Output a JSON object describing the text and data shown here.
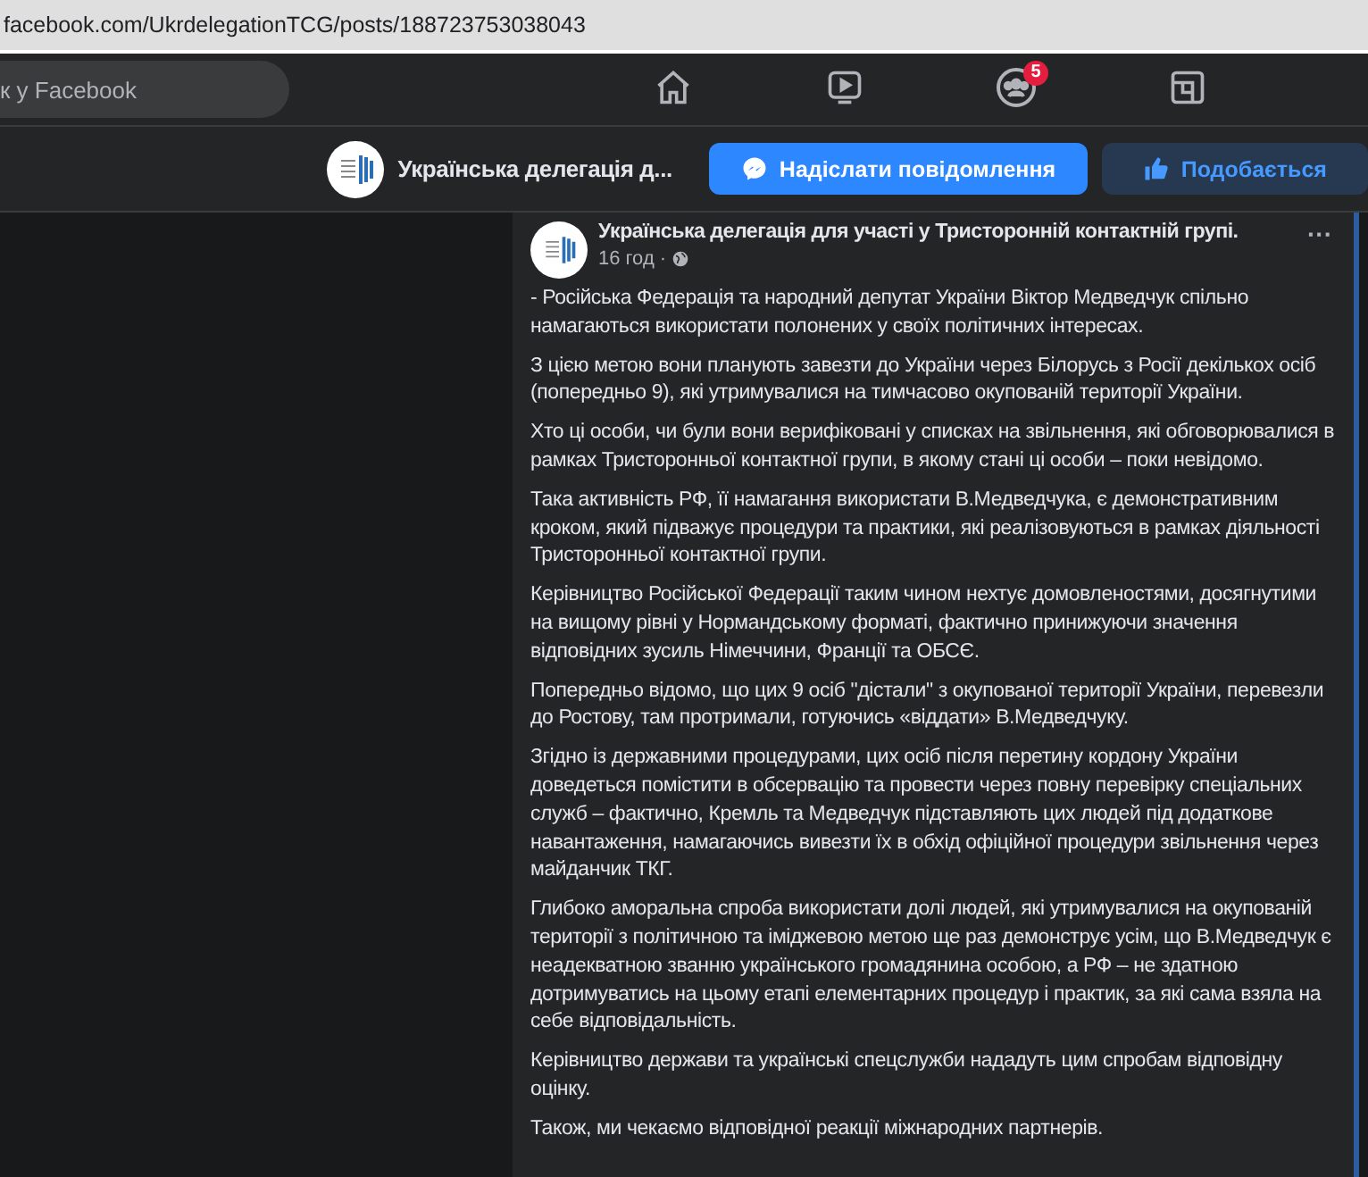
{
  "address_bar": {
    "url": "facebook.com/UkrdelegationTCG/posts/188723753038043"
  },
  "top_nav": {
    "search": {
      "placeholder": "к у Facebook"
    },
    "tabs": [
      {
        "kind": "home",
        "selected": false
      },
      {
        "kind": "watch",
        "selected": false
      },
      {
        "kind": "groups",
        "selected": false,
        "badge": "5"
      },
      {
        "kind": "gaming",
        "selected": false
      }
    ]
  },
  "page_header": {
    "title": "Українська делегація д...",
    "buttons": [
      {
        "kind": "message",
        "label": "Надіслати повідомлення"
      },
      {
        "kind": "like",
        "label": "Подобається"
      }
    ]
  },
  "post": {
    "author": "Українська делегація для участі у Тристоронній контактній групі.",
    "time": "16 год ·",
    "menu": "···",
    "paragraphs": [
      "- Російська Федерація та народний депутат України Віктор Медведчук спільно намагаються використати полонених у своїх політичних інтересах.",
      "З цією метою вони планують завезти до України через Білорусь з Росії декількох осіб (попередньо 9), які утримувалися на тимчасово окупованій території України.",
      "Хто ці особи, чи були вони верифіковані у списках на звільнення, які обговорювалися в рамках Тристоронньої контактної групи, в якому стані ці особи – поки невідомо.",
      "Така активність РФ, її намагання використати В.Медведчука, є демонстративним кроком, який підважує процедури та практики, які реалізовуються в рамках діяльності Тристоронньої контактної групи.",
      "Керівництво Російської Федерації таким чином нехтує домовленостями, досягнутими на вищому рівні у Нормандському форматі, фактично принижуючи значення відповідних зусиль  Німеччини, Франції та ОБСЄ.",
      "Попередньо відомо, що цих 9 осіб \"дістали\" з окупованої території України, перевезли до Ростову, там протримали, готуючись «віддати» В.Медведчуку.",
      "Згідно із державними процедурами, цих осіб після перетину кордону України доведеться помістити в обсервацію та провести через повну перевірку спеціальних служб – фактично, Кремль та Медведчук підставляють цих людей під додаткове навантаження, намагаючись вивезти їх в обхід офіційної процедури звільнення через майданчик ТКГ.",
      "Глибоко аморальна спроба використати долі людей, які утримувалися на окупованій території з політичною та іміджевою метою ще раз демонструє усім, що В.Медведчук є неадекватною званню українського громадянина особою, а РФ – не здатною дотримуватись на цьому етапі елементарних процедур і практик, за які сама взяла на себе відповідальність.",
      "Керівництво держави та українські спецслужби нададуть цим спробам відповідну оцінку.",
      "Також, ми чекаємо відповідної реакції міжнародних партнерів."
    ]
  }
}
